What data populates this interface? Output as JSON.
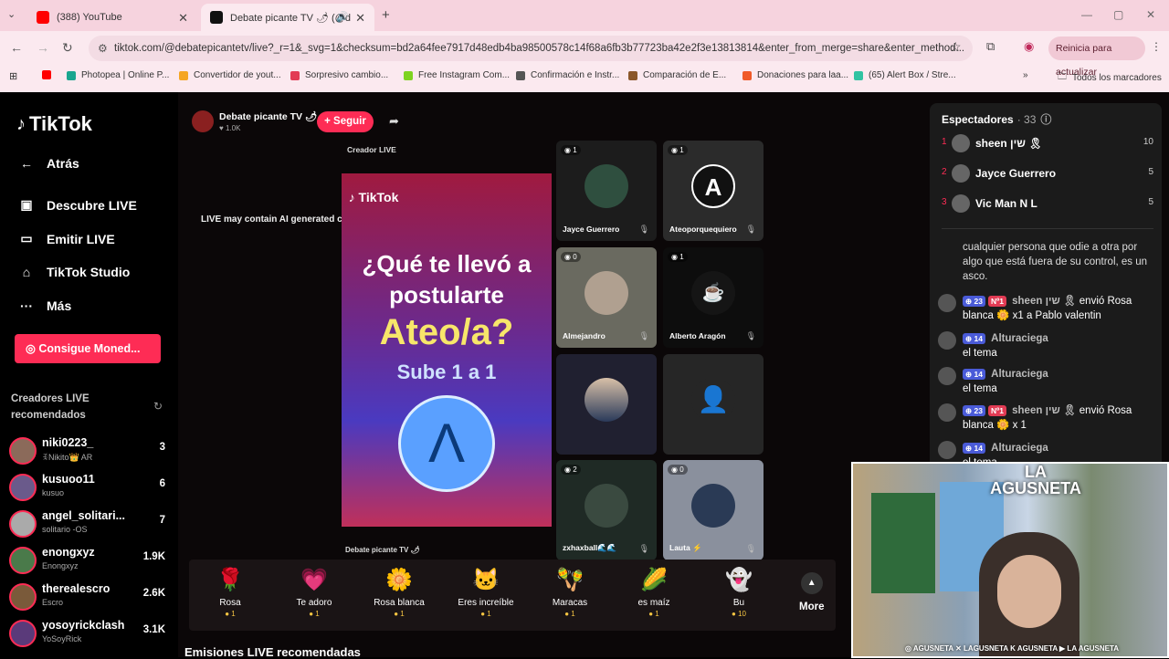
{
  "browser": {
    "tabs": [
      {
        "title": "(388) YouTube",
        "color": "#ff0000"
      },
      {
        "title": "Debate picante TV 🌶 (@d",
        "color": "#111111"
      }
    ],
    "url": "tiktok.com/@debatepicantetv/live?_r=1&_svg=1&checksum=bd2a64fee7917d48edb4ba98500578c14f68a6fb3b77723ba42e2f3e13813814&enter_from_merge=share&enter_method...",
    "update_label": "Reinicia para actualizar",
    "bookmarks": [
      {
        "label": "Photopea | Online P...",
        "color": "#19a68f"
      },
      {
        "label": "Convertidor de yout...",
        "color": "#f5a623"
      },
      {
        "label": "Sorpresivo cambio...",
        "color": "#e23b54"
      },
      {
        "label": "Free Instagram Com...",
        "color": "#7ed321"
      },
      {
        "label": "Confirmación e Instr...",
        "color": "#555555"
      },
      {
        "label": "Comparación de E...",
        "color": "#8b572a"
      },
      {
        "label": "Donaciones para laa...",
        "color": "#f05a28"
      },
      {
        "label": "(65) Alert Box / Stre...",
        "color": "#31c3a2"
      }
    ],
    "all_bookmarks": "Todos los marcadores"
  },
  "sidebar": {
    "logo": "TikTok",
    "nav": [
      {
        "label": "Atrás",
        "icon": "←"
      },
      {
        "label": "Descubre LIVE",
        "icon": "▣"
      },
      {
        "label": "Emitir LIVE",
        "icon": "▭"
      },
      {
        "label": "TikTok Studio",
        "icon": "⌂"
      },
      {
        "label": "Más",
        "icon": "···"
      }
    ],
    "coins_button": "Consigue Moned...",
    "section_title": "Creadores LIVE recomendados",
    "creators": [
      {
        "name": "niki0223_",
        "sub": "ꉂNikito👑 AR",
        "count": "3"
      },
      {
        "name": "kusuoo11",
        "sub": "kusuo",
        "count": "6"
      },
      {
        "name": "angel_solitari...",
        "sub": "solitario -OS",
        "count": "7"
      },
      {
        "name": "enongxyz",
        "sub": "Enongxyz",
        "count": "1.9K"
      },
      {
        "name": "therealescro",
        "sub": "Escro",
        "count": "2.6K"
      },
      {
        "name": "yosoyrickclash",
        "sub": "YoSoyRick",
        "count": "3.1K"
      }
    ]
  },
  "stream": {
    "host_name": "Debate picante TV 🌶",
    "host_likes": "♥ 1.0K",
    "follow_label": "+ Seguir",
    "ai_notice": "LIVE may contain AI generated content",
    "creator_live_label": "Creador LIVE",
    "poster_brand": "TikTok",
    "poster_question": "¿Qué te llevó a postularte",
    "poster_highlight": "Ateo/a?",
    "poster_sub": "Sube 1 a 1",
    "poster_footer": "Debate picante TV 🌶",
    "guests": [
      {
        "name": "Jayce Guerrero",
        "badge": "1",
        "color": "#2f4f3f"
      },
      {
        "name": "Ateoporquequiero",
        "badge": "1",
        "color": "#222222"
      },
      {
        "name": "Almejandro",
        "badge": "0",
        "color": "#8a8a7a"
      },
      {
        "name": "Alberto Aragón",
        "badge": "1",
        "color": "#0d0d0d"
      },
      {
        "name": "",
        "badge": "",
        "color": "#3a3550"
      },
      {
        "name": "",
        "badge": "",
        "color": "#2a2a2a"
      },
      {
        "name": "zxhaxball🌊🌊",
        "badge": "2",
        "color": "#1f2a25"
      },
      {
        "name": "Lauta ⚡",
        "badge": "0",
        "color": "#9aa0ad"
      }
    ],
    "gifts": [
      {
        "name": "Rosa",
        "price": "1",
        "icon": "🌹"
      },
      {
        "name": "Te adoro",
        "price": "1",
        "icon": "💗"
      },
      {
        "name": "Rosa blanca",
        "price": "1",
        "icon": "🌼"
      },
      {
        "name": "Eres increíble",
        "price": "1",
        "icon": "🐱"
      },
      {
        "name": "Maracas",
        "price": "1",
        "icon": "🪇"
      },
      {
        "name": "es maíz",
        "price": "1",
        "icon": "🌽"
      },
      {
        "name": "Bu",
        "price": "10",
        "icon": "👻"
      }
    ],
    "more_label": "More",
    "recommended_title": "Emisiones LIVE recomendadas"
  },
  "chat": {
    "spectators_label": "Espectadores",
    "spectators_count": "· 33",
    "top_viewers": [
      {
        "rank": "1",
        "name": "sheen שין 🎗",
        "score": "10"
      },
      {
        "rank": "2",
        "name": "Jayce Guerrero",
        "score": "5"
      },
      {
        "rank": "3",
        "name": "Vic Man N L",
        "score": "5"
      }
    ],
    "messages": [
      {
        "level": "",
        "badge2": "",
        "user": "",
        "text": "cualquier persona que odie a otra por algo que está fuera de su control, es un asco."
      },
      {
        "level": "23",
        "badge2": "Nº1",
        "user": "sheen שין 🎗",
        "text": "envió Rosa blanca 🌼 x1 a Pablo valentin"
      },
      {
        "level": "14",
        "badge2": "",
        "user": "Alturaciega",
        "text": "el tema"
      },
      {
        "level": "14",
        "badge2": "",
        "user": "Alturaciega",
        "text": "el tema"
      },
      {
        "level": "23",
        "badge2": "Nº1",
        "user": "sheen שין 🎗",
        "text": "envió Rosa blanca 🌼 x 1"
      },
      {
        "level": "14",
        "badge2": "",
        "user": "Alturaciega",
        "text": "el tema"
      }
    ]
  },
  "webcam": {
    "overlay_label": "LA AGUSNETA",
    "socials": "◎ AGUSNETA  ✕ LAGUSNETA  K AGUSNETA  ▶ LA AGUSNETA"
  }
}
